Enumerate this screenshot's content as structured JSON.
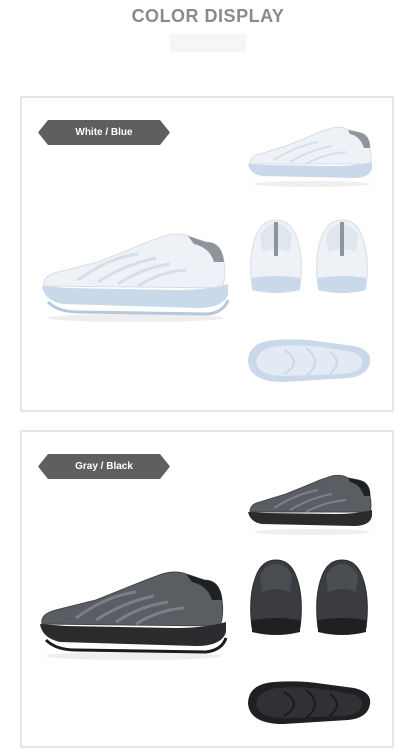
{
  "header": {
    "title": "COLOR DISPLAY"
  },
  "variants": [
    {
      "label": "White / Blue",
      "upper_color": "#eef2f6",
      "sole_color": "#c9d9ea",
      "accent_color": "#8c949c",
      "stripe_color": "#d6dee8"
    },
    {
      "label": "Gray / Black",
      "upper_color": "#5a5e63",
      "sole_color": "#2a2b2d",
      "accent_color": "#1f2022",
      "stripe_color": "#7b8087"
    }
  ]
}
